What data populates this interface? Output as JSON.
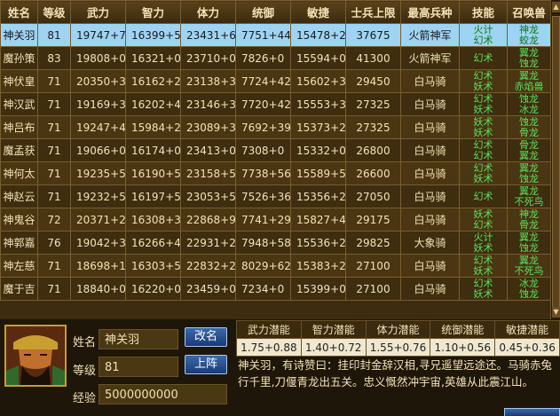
{
  "table": {
    "headers": [
      "姓名",
      "等级",
      "武力",
      "智力",
      "体力",
      "统御",
      "敏捷",
      "士兵上限",
      "最高兵种",
      "技能",
      "召唤兽"
    ],
    "rows": [
      {
        "name": "神关羽",
        "level": "81",
        "wuli": "19747+7",
        "zhili": "16399+5",
        "tili": "23431+6",
        "tongyu": "7751+44",
        "minjie": "15478+2",
        "cap": "37675",
        "unit": "火箭神军",
        "skills": [
          "火计",
          "幻术"
        ],
        "beasts": [
          "神龙",
          "蛟龙"
        ],
        "selected": true
      },
      {
        "name": "魔孙策",
        "level": "83",
        "wuli": "19808+0",
        "zhili": "16321+0",
        "tili": "23710+0",
        "tongyu": "7826+0",
        "minjie": "15594+0",
        "cap": "41300",
        "unit": "火箭神军",
        "skills": [
          "幻术"
        ],
        "beasts": [
          "翼龙",
          "蚀龙"
        ]
      },
      {
        "name": "神伏皇",
        "level": "71",
        "wuli": "20350+3",
        "zhili": "16162+2",
        "tili": "23138+3",
        "tongyu": "7724+42",
        "minjie": "15602+3",
        "cap": "29450",
        "unit": "白马骑",
        "skills": [
          "幻术",
          "妖术"
        ],
        "beasts": [
          "翼龙",
          "赤焰兽"
        ]
      },
      {
        "name": "神汉武",
        "level": "71",
        "wuli": "19169+3",
        "zhili": "16202+4",
        "tili": "23146+3",
        "tongyu": "7720+42",
        "minjie": "15553+3",
        "cap": "27325",
        "unit": "白马骑",
        "skills": [
          "幻术",
          "妖术"
        ],
        "beasts": [
          "蚀龙",
          "冰龙"
        ]
      },
      {
        "name": "神吕布",
        "level": "71",
        "wuli": "19247+4",
        "zhili": "15984+2",
        "tili": "23089+3",
        "tongyu": "7692+39",
        "minjie": "15373+2",
        "cap": "27325",
        "unit": "白马骑",
        "skills": [
          "妖术",
          "妖术"
        ],
        "beasts": [
          "蚀龙",
          "骨龙"
        ]
      },
      {
        "name": "魔孟获",
        "level": "71",
        "wuli": "19066+0",
        "zhili": "16174+0",
        "tili": "23413+0",
        "tongyu": "7308+0",
        "minjie": "15332+0",
        "cap": "26800",
        "unit": "白马骑",
        "skills": [
          "幻术",
          "幻术"
        ],
        "beasts": [
          "骨龙",
          "翼龙"
        ]
      },
      {
        "name": "神何太",
        "level": "71",
        "wuli": "19235+5",
        "zhili": "16190+5",
        "tili": "23158+5",
        "tongyu": "7738+56",
        "minjie": "15589+5",
        "cap": "26600",
        "unit": "白马骑",
        "skills": [
          "幻术",
          "妖术"
        ],
        "beasts": [
          "翼龙",
          "蚀龙"
        ]
      },
      {
        "name": "神赵云",
        "level": "71",
        "wuli": "19232+5",
        "zhili": "16197+5",
        "tili": "23053+5",
        "tongyu": "7526+36",
        "minjie": "15356+2",
        "cap": "27050",
        "unit": "白马骑",
        "skills": [
          "幻术"
        ],
        "beasts": [
          "翼龙",
          "不死鸟"
        ]
      },
      {
        "name": "神鬼谷",
        "level": "72",
        "wuli": "20371+2",
        "zhili": "16308+3",
        "tili": "22868+9",
        "tongyu": "7741+29",
        "minjie": "15827+4",
        "cap": "29175",
        "unit": "白马骑",
        "skills": [
          "妖术",
          "幻术"
        ],
        "beasts": [
          "神龙",
          "骨龙"
        ]
      },
      {
        "name": "神郭嘉",
        "level": "76",
        "wuli": "19042+3",
        "zhili": "16266+4",
        "tili": "22931+2",
        "tongyu": "7948+58",
        "minjie": "15536+2",
        "cap": "29825",
        "unit": "大象骑",
        "skills": [
          "火计",
          "妖术"
        ],
        "beasts": [
          "翼龙",
          "蚀龙"
        ]
      },
      {
        "name": "神左慈",
        "level": "71",
        "wuli": "18698+1",
        "zhili": "16303+5",
        "tili": "22832+2",
        "tongyu": "8029+62",
        "minjie": "15383+2",
        "cap": "27100",
        "unit": "白马骑",
        "skills": [
          "幻术",
          "妖术"
        ],
        "beasts": [
          "翼龙",
          "不死鸟"
        ]
      },
      {
        "name": "魔于吉",
        "level": "71",
        "wuli": "18840+0",
        "zhili": "16220+0",
        "tili": "23459+0",
        "tongyu": "7234+0",
        "minjie": "15399+0",
        "cap": "27100",
        "unit": "白马骑",
        "skills": [
          "幻术",
          "妖术"
        ],
        "beasts": [
          "冰龙",
          "蚀龙"
        ]
      }
    ]
  },
  "details": {
    "name_label": "姓名",
    "level_label": "等级",
    "exp_label": "经验",
    "name_value": "神关羽",
    "level_value": "81",
    "exp_value": "5000000000",
    "rename_button": "改名",
    "deploy_button": "上阵",
    "potential_headers": [
      "武力潜能",
      "智力潜能",
      "体力潜能",
      "统御潜能",
      "敏捷潜能"
    ],
    "potential_values": [
      "1.75+0.88",
      "1.40+0.72",
      "1.55+0.76",
      "1.10+0.56",
      "0.45+0.36"
    ],
    "description": "神关羽，有诗赞曰：挂印封金辞汉相,寻兄遥望远途还。马骑赤兔行千里,刀偃青龙出五关。忠义慨然冲宇宙,英雄从此震江山。"
  },
  "colors": {
    "selected_row": "#9fd3f3",
    "skill_text": "#5be35b",
    "panel_bg": "#1e1608"
  }
}
